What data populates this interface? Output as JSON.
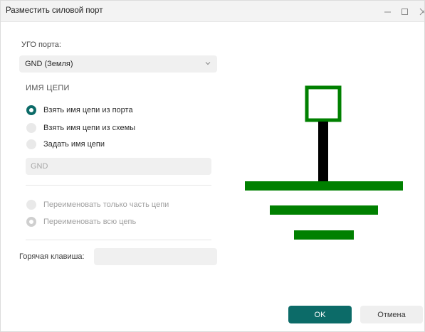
{
  "window": {
    "title": "Разместить силовой порт"
  },
  "port_symbol": {
    "label": "УГО порта:",
    "selected": "GND (Земля)"
  },
  "net_name": {
    "section_title": "ИМЯ ЦЕПИ",
    "options": [
      {
        "label": "Взять имя цепи из порта",
        "checked": true
      },
      {
        "label": "Взять имя цепи из схемы",
        "checked": false
      },
      {
        "label": "Задать имя цепи",
        "checked": false
      }
    ],
    "value": "GND"
  },
  "rename": {
    "options": [
      {
        "label": "Переименовать только часть цепи",
        "disabled": true
      },
      {
        "label": "Переименовать всю цепь",
        "disabled": true,
        "checked": true
      }
    ]
  },
  "hotkey": {
    "label": "Горячая клавиша:",
    "value": ""
  },
  "buttons": {
    "ok": "OK",
    "cancel": "Отмена"
  },
  "colors": {
    "accent": "#0c6b68",
    "symbol_green": "#008000",
    "symbol_black": "#000000"
  }
}
